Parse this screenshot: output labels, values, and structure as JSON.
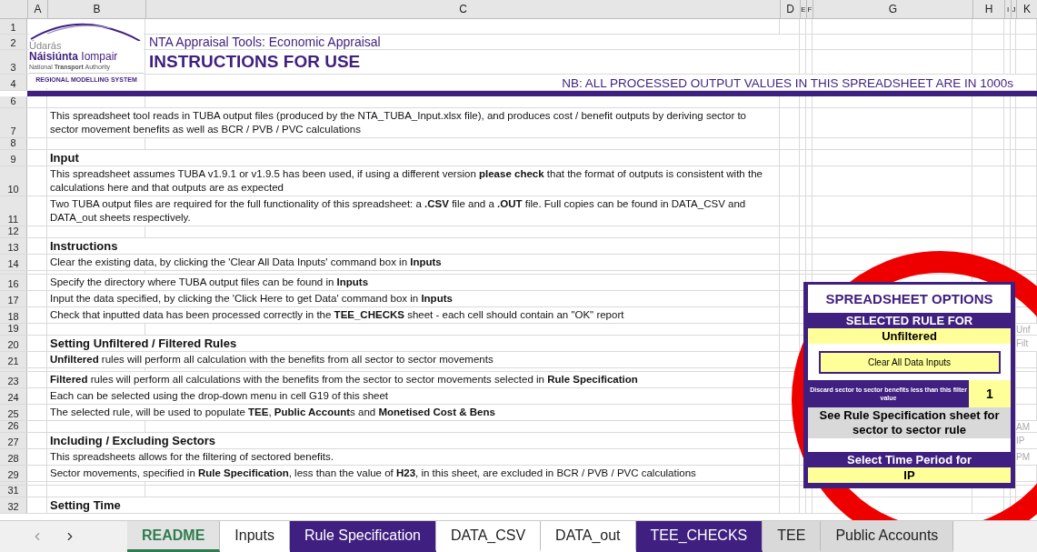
{
  "columns": [
    "A",
    "B",
    "C",
    "D",
    "E",
    "F",
    "G",
    "H",
    "I",
    "J",
    "K"
  ],
  "header": {
    "row_numbers": [
      "1",
      "2",
      "3",
      "4"
    ],
    "subtitle": "NTA Appraisal Tools: Economic Appraisal",
    "title": "INSTRUCTIONS FOR USE",
    "note": "NB: ALL PROCESSED OUTPUT VALUES IN THIS SPREADSHEET ARE IN 1000s"
  },
  "logo": {
    "line1": "Údarás",
    "line2": "**Náisiúnta** Iompair",
    "line3": "National **Transport** Authority",
    "tagline": "REGIONAL MODELLING SYSTEM"
  },
  "rows": [
    {
      "n": "6",
      "kind": "blank"
    },
    {
      "n": "7",
      "kind": "text",
      "text": "This spreadsheet tool reads in TUBA output files (produced by the NTA_TUBA_Input.xlsx file), and produces cost / benefit outputs by deriving sector to sector movement benefits as well as BCR / PVB / PVC calculations"
    },
    {
      "n": "8",
      "kind": "blank"
    },
    {
      "n": "9",
      "kind": "heading",
      "text": "Input"
    },
    {
      "n": "10",
      "kind": "text",
      "text": "This spreadsheet assumes TUBA v1.9.1 or v1.9.5 has been used, if using a different version **please check**  that the format of outputs is consistent with the calculations here and that outputs are as expected"
    },
    {
      "n": "11",
      "kind": "text",
      "text": "Two TUBA output files are required for the full functionality of this spreadsheet: a **.CSV**  file  and a **.OUT**  file. Full copies can be found in DATA_CSV and DATA_out sheets respectively."
    },
    {
      "n": "12",
      "kind": "blank"
    },
    {
      "n": "13",
      "kind": "heading",
      "text": "Instructions"
    },
    {
      "n": "14",
      "kind": "text",
      "text": "Clear the existing data, by clicking the 'Clear All Data Inputs' command box in **Inputs**"
    },
    {
      "kind": "thin"
    },
    {
      "n": "16",
      "kind": "text",
      "text": "Specify the directory where TUBA output files can be found in **Inputs**"
    },
    {
      "n": "17",
      "kind": "text",
      "text": "Input the data specified, by clicking the 'Click Here to get Data' command box in **Inputs**"
    },
    {
      "n": "18",
      "kind": "text",
      "text": "Check that inputted data has been processed correctly in the **TEE_CHECKS**  sheet - each cell should contain an \"OK\" report"
    },
    {
      "n": "19",
      "kind": "blank",
      "side": "Unf"
    },
    {
      "n": "20",
      "kind": "heading",
      "text": "Setting Unfiltered / Filtered Rules",
      "side": "Filt"
    },
    {
      "n": "21",
      "kind": "text",
      "text": "**Unfiltered** rules will perform all calculation with the benefits from all sector to sector movements"
    },
    {
      "kind": "thin"
    },
    {
      "n": "23",
      "kind": "text",
      "text": "**Filtered** rules will perform all calculations with the benefits from the  sector to sector movements selected in **Rule Specification**"
    },
    {
      "n": "24",
      "kind": "text",
      "text": "Each can be selected using the drop-down menu in cell G19 of this sheet"
    },
    {
      "n": "25",
      "kind": "text",
      "text": "The selected rule, will be used to populate **TEE**, **Public Account**s and **Monetised Cost & Bens**"
    },
    {
      "n": "26",
      "kind": "blank",
      "side": "AM"
    },
    {
      "n": "27",
      "kind": "heading",
      "text": "Including / Excluding Sectors",
      "side": "IP"
    },
    {
      "n": "28",
      "kind": "text",
      "text": "This spreadsheets allows for the filtering of sectored benefits.",
      "side": "PM"
    },
    {
      "n": "29",
      "kind": "text",
      "text": "Sector movements, specified in **Rule Specification**, less than the value of **H23**, in this sheet, are excluded in BCR / PVB / PVC calculations"
    },
    {
      "kind": "thin"
    },
    {
      "n": "31",
      "kind": "blank"
    },
    {
      "n": "32",
      "kind": "heading",
      "text": "Setting Time"
    }
  ],
  "options": {
    "title": "SPREADSHEET OPTIONS",
    "rule_label": "SELECTED RULE FOR",
    "rule_value": "Unfiltered",
    "clear_button": "Clear All Data Inputs",
    "filter_label": "Discard sector to sector benefits less than this filter value",
    "filter_value": "1",
    "note": "See Rule Specification sheet for sector to sector rule",
    "period_label": "Select Time Period for",
    "period_value": "IP"
  },
  "sheet_tabs": [
    {
      "label": "README",
      "selected": true,
      "color": "#2e7d4f"
    },
    {
      "label": "Inputs",
      "selected": false,
      "color": "#ffffff"
    },
    {
      "label": "Rule Specification",
      "selected": false,
      "color": "#3f1f7f"
    },
    {
      "label": "DATA_CSV",
      "selected": false,
      "color": "#ffffff"
    },
    {
      "label": "DATA_out",
      "selected": false,
      "color": "#ffffff"
    },
    {
      "label": "TEE_CHECKS",
      "selected": false,
      "color": "#3f1f7f"
    },
    {
      "label": "TEE",
      "selected": false,
      "color": "#d9d9d9"
    },
    {
      "label": "Public Accounts",
      "selected": false,
      "color": "#d9d9d9"
    }
  ]
}
